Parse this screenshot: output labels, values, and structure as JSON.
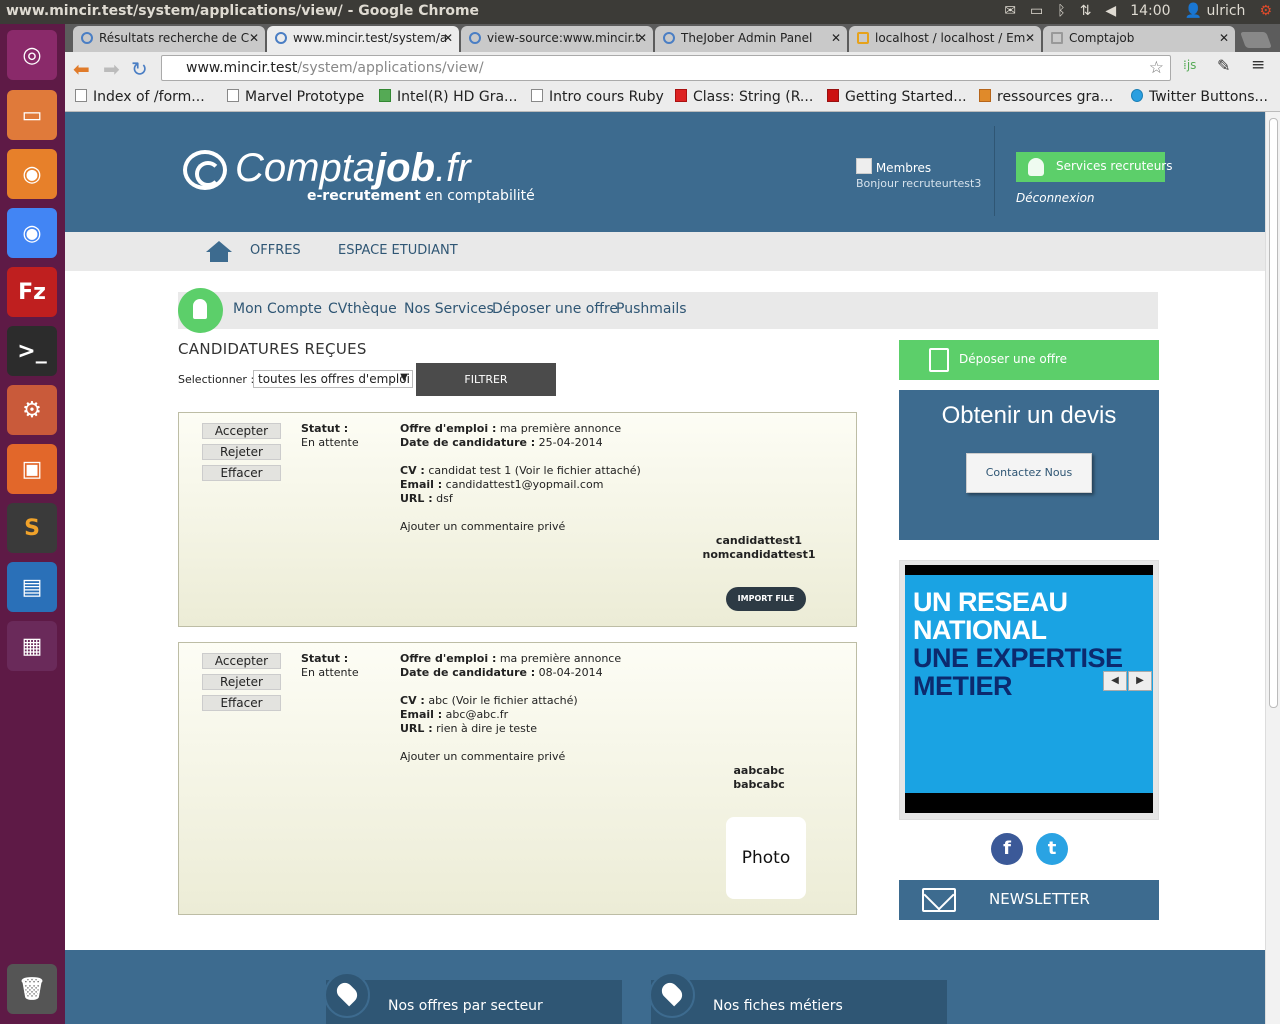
{
  "os": {
    "window_title": "www.mincir.test/system/applications/view/ - Google Chrome",
    "clock": "14:00",
    "user": "ulrich"
  },
  "browser": {
    "tabs": [
      {
        "label": "Résultats recherche de C"
      },
      {
        "label": "www.mincir.test/system/a"
      },
      {
        "label": "view-source:www.mincir.t"
      },
      {
        "label": "TheJober Admin Panel"
      },
      {
        "label": "localhost / localhost / Em"
      },
      {
        "label": "Comptajob"
      }
    ],
    "url_host": "www.mincir.test",
    "url_path": "/system/applications/view/",
    "bookmarks": [
      {
        "label": "Index of /form..."
      },
      {
        "label": "Marvel Prototype"
      },
      {
        "label": "Intel(R) HD Gra..."
      },
      {
        "label": "Intro cours Ruby"
      },
      {
        "label": "Class: String (R..."
      },
      {
        "label": "Getting Started..."
      },
      {
        "label": "ressources gra..."
      },
      {
        "label": "Twitter Buttons..."
      }
    ]
  },
  "site": {
    "logo_a": "Compta",
    "logo_b": "job",
    "logo_c": ".fr",
    "tagline_a": "e-recrutement",
    "tagline_b": " en comptabilité",
    "membres": "Membres",
    "bonjour": "Bonjour recruteurtest3",
    "services_btn": "Services recruteurs",
    "deconnexion": "Déconnexion",
    "nav": [
      "OFFRES",
      "ESPACE ETUDIANT"
    ],
    "subnav": [
      "Mon Compte",
      "CVthèque",
      "Nos Services",
      "Déposer une offre",
      "Pushmails"
    ]
  },
  "main": {
    "title": "CANDIDATURES REÇUES",
    "select_label": "Selectionner :",
    "select_value": "toutes les offres d'emploi",
    "filter_btn": "FILTRER",
    "buttons": {
      "accept": "Accepter",
      "reject": "Rejeter",
      "delete": "Effacer"
    },
    "labels": {
      "statut": "Statut :",
      "offre": "Offre d'emploi :",
      "date": "Date de candidature :",
      "cv": "CV :",
      "email": "Email :",
      "url": "URL :",
      "comment": "Ajouter un commentaire privé"
    },
    "applications": [
      {
        "status": "En attente",
        "offer": " ma première annonce",
        "date": " 25-04-2014",
        "cv": " candidat test 1 (Voir le fichier attaché)",
        "email": " candidattest1@yopmail.com",
        "url": " dsf",
        "first_name": "candidattest1",
        "last_name": "nomcandidattest1",
        "action": "IMPORT FILE"
      },
      {
        "status": "En attente",
        "offer": " ma première annonce",
        "date": " 08-04-2014",
        "cv": " abc (Voir le fichier attaché)",
        "email": " abc@abc.fr",
        "url": " rien à dire je teste",
        "first_name": "aabcabc",
        "last_name": "babcabc",
        "action": "Photo"
      }
    ]
  },
  "sidebar": {
    "deposer": "Déposer une offre",
    "devis_title": "Obtenir un devis",
    "devis_btn": "Contactez Nous",
    "ad_lines": [
      "UN RESEAU",
      "NATIONAL",
      "UNE EXPERTISE",
      "METIER"
    ],
    "newsletter": "NEWSLETTER"
  },
  "footer": {
    "secteur": "Nos offres par secteur",
    "fiches": "Nos fiches métiers"
  },
  "colors": {
    "brand_blue": "#3d6b8f",
    "brand_green": "#5ccf6a",
    "launcher": "#5e1a46"
  }
}
